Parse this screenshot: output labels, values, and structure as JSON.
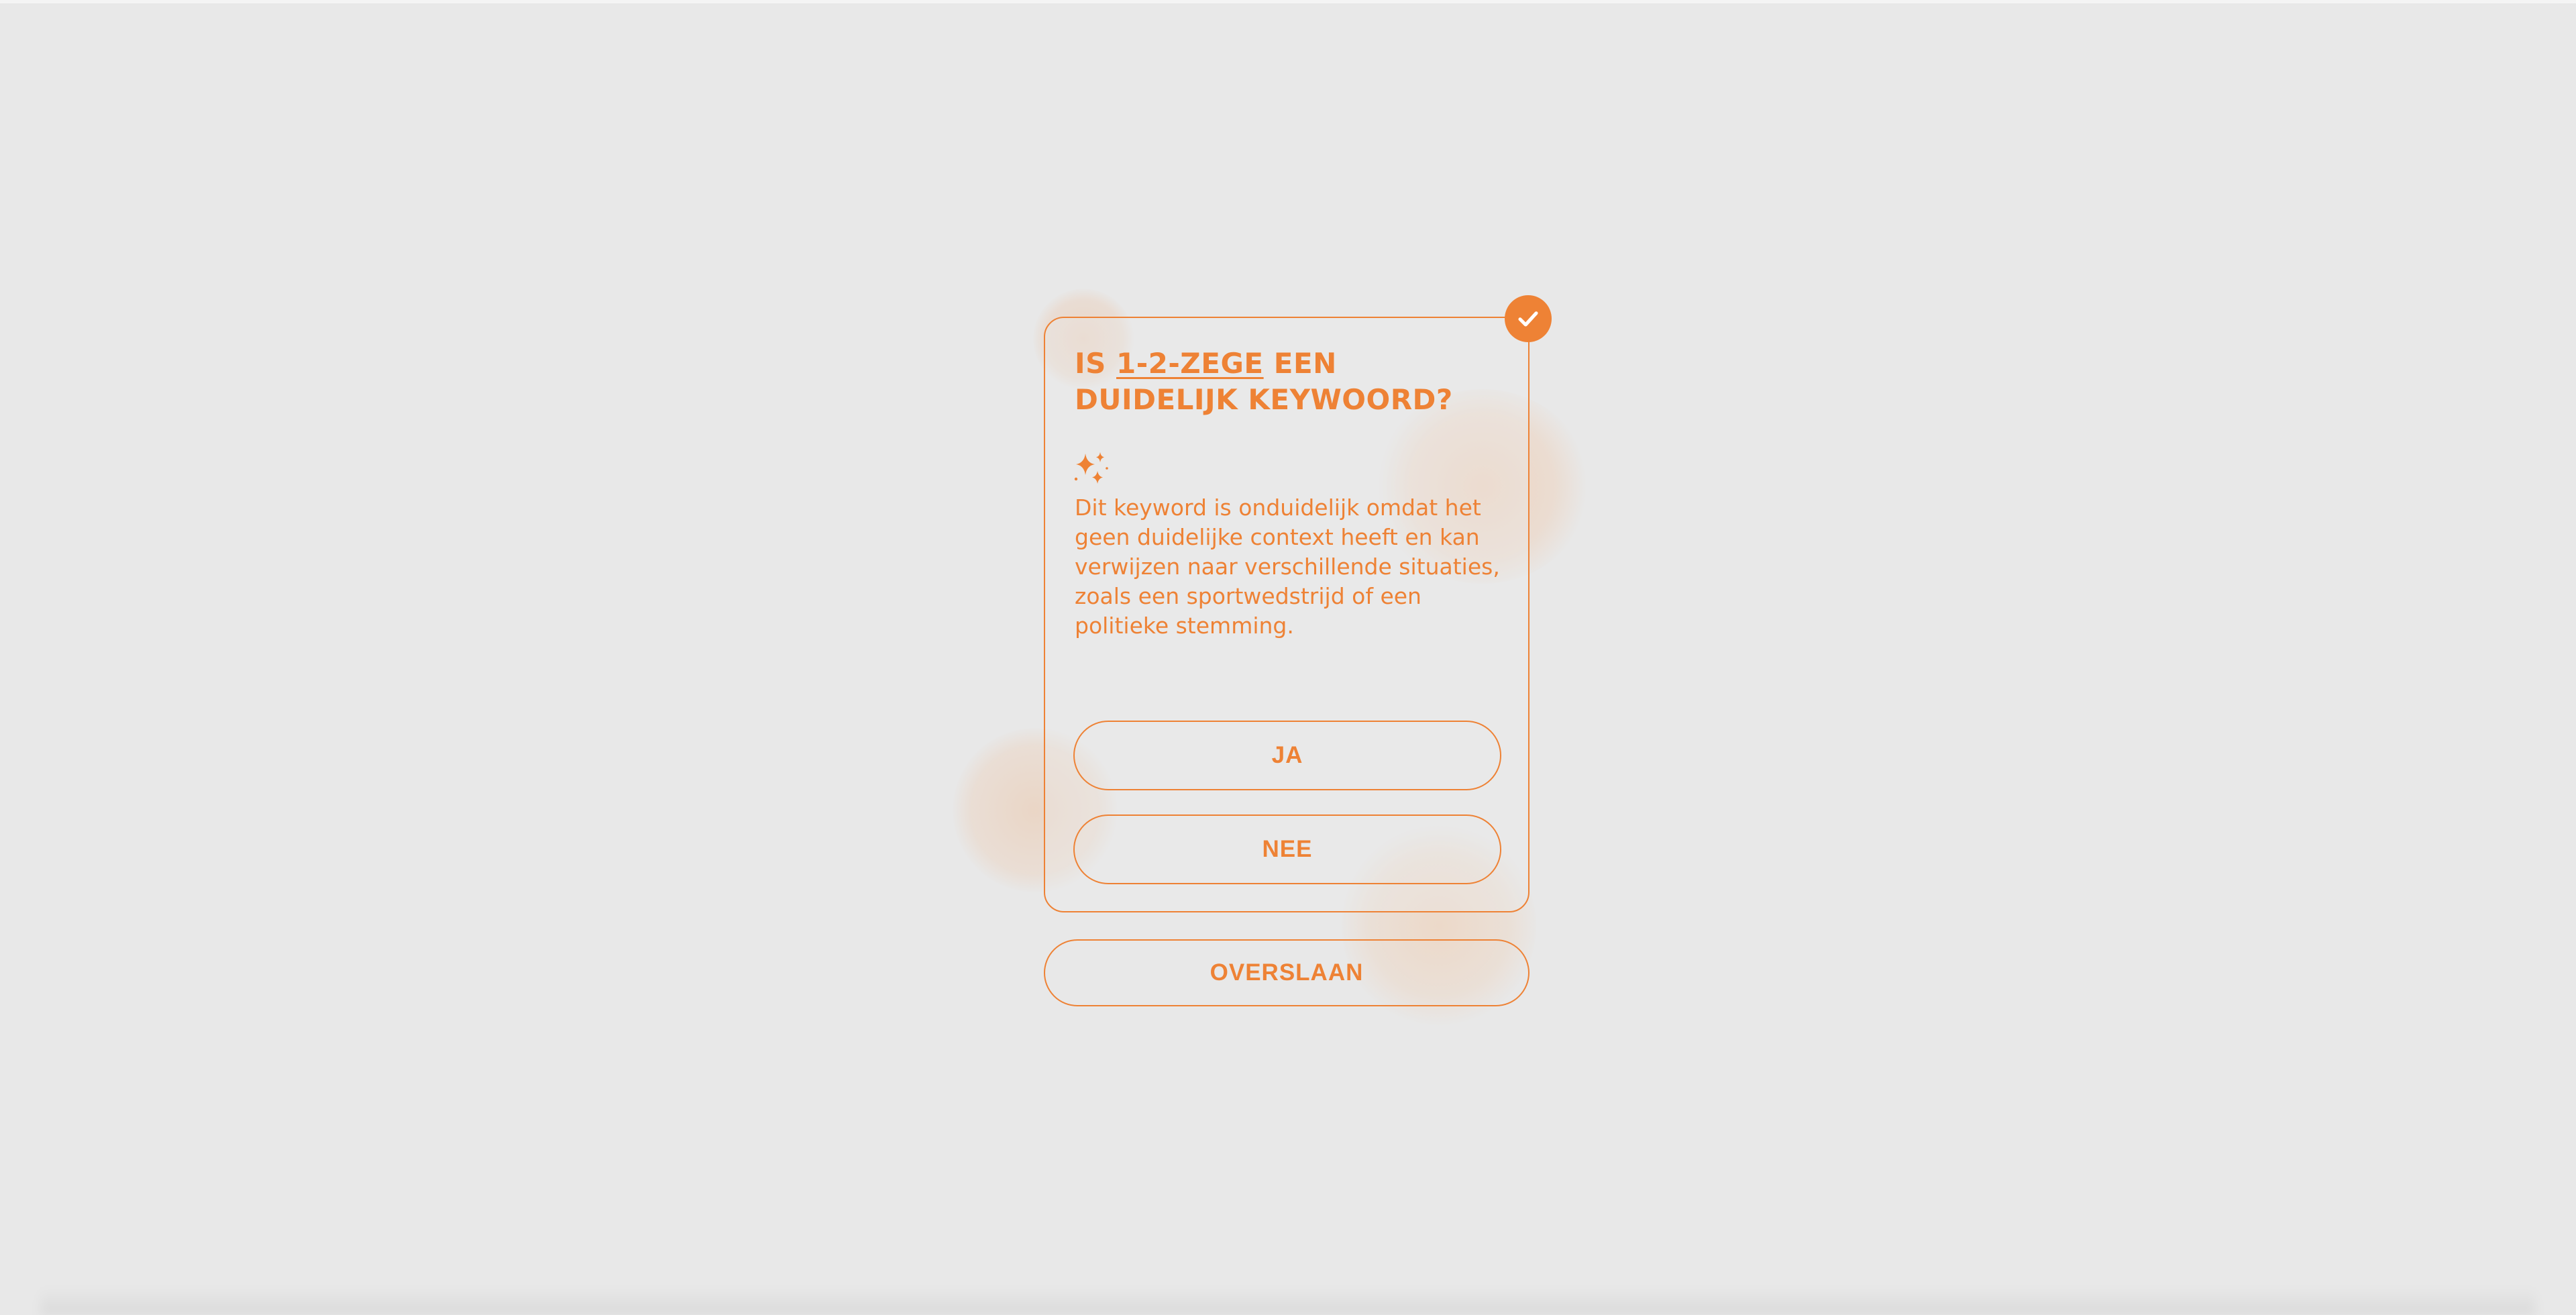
{
  "theme": {
    "accent": "#ee8235",
    "background": "#e8e8e8"
  },
  "card": {
    "status_icon": "check-icon",
    "title_prefix": "IS ",
    "keyword": "1-2-ZEGE",
    "title_suffix": " EEN DUIDELIJK KEYWOORD?",
    "explanation_icon": "sparkles-icon",
    "explanation": "Dit keyword is onduidelijk omdat het geen duidelijke context heeft en kan verwijzen naar verschillende situaties, zoals een sportwedstrijd of een politieke stemming."
  },
  "actions": {
    "yes_label": "JA",
    "no_label": "NEE",
    "skip_label": "OVERSLAAN"
  }
}
